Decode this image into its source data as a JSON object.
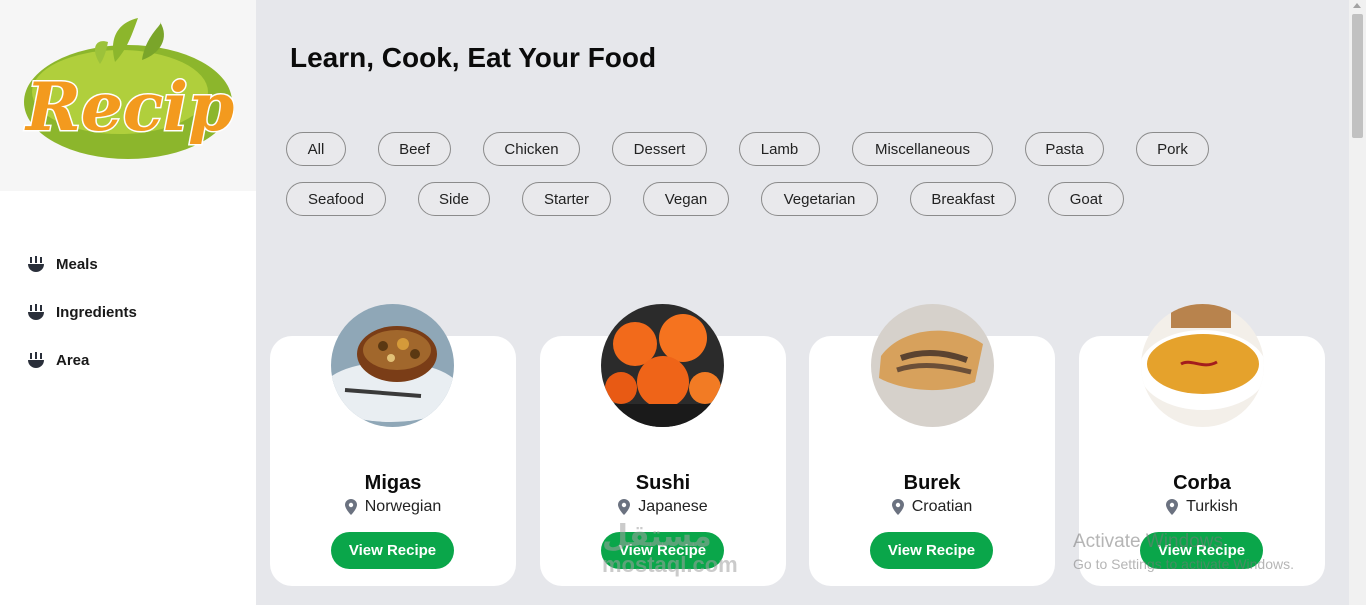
{
  "sidebar": {
    "logo_text": "Recipe",
    "nav": [
      {
        "label": "Meals",
        "icon": "food-bowl-icon"
      },
      {
        "label": "Ingredients",
        "icon": "food-bowl-icon"
      },
      {
        "label": "Area",
        "icon": "food-bowl-icon"
      }
    ]
  },
  "main": {
    "title": "Learn, Cook, Eat Your Food",
    "categories": [
      "All",
      "Beef",
      "Chicken",
      "Dessert",
      "Lamb",
      "Miscellaneous",
      "Pasta",
      "Pork",
      "Seafood",
      "Side",
      "Starter",
      "Vegan",
      "Vegetarian",
      "Breakfast",
      "Goat"
    ],
    "meals": [
      {
        "name": "Migas",
        "area": "Norwegian",
        "button": "View Recipe"
      },
      {
        "name": "Sushi",
        "area": "Japanese",
        "button": "View Recipe"
      },
      {
        "name": "Burek",
        "area": "Croatian",
        "button": "View Recipe"
      },
      {
        "name": "Corba",
        "area": "Turkish",
        "button": "View Recipe"
      }
    ]
  },
  "overlay": {
    "windows_title": "Activate Windows",
    "windows_sub": "Go to Settings to activate Windows.",
    "mostaql_ar": "مستقل",
    "mostaql_en": "mostaql.com"
  },
  "colors": {
    "accent_green": "#0aa64a",
    "background": "#e6e7eb",
    "logo_orange": "#f39a1e",
    "logo_green": "#8cb62c"
  }
}
